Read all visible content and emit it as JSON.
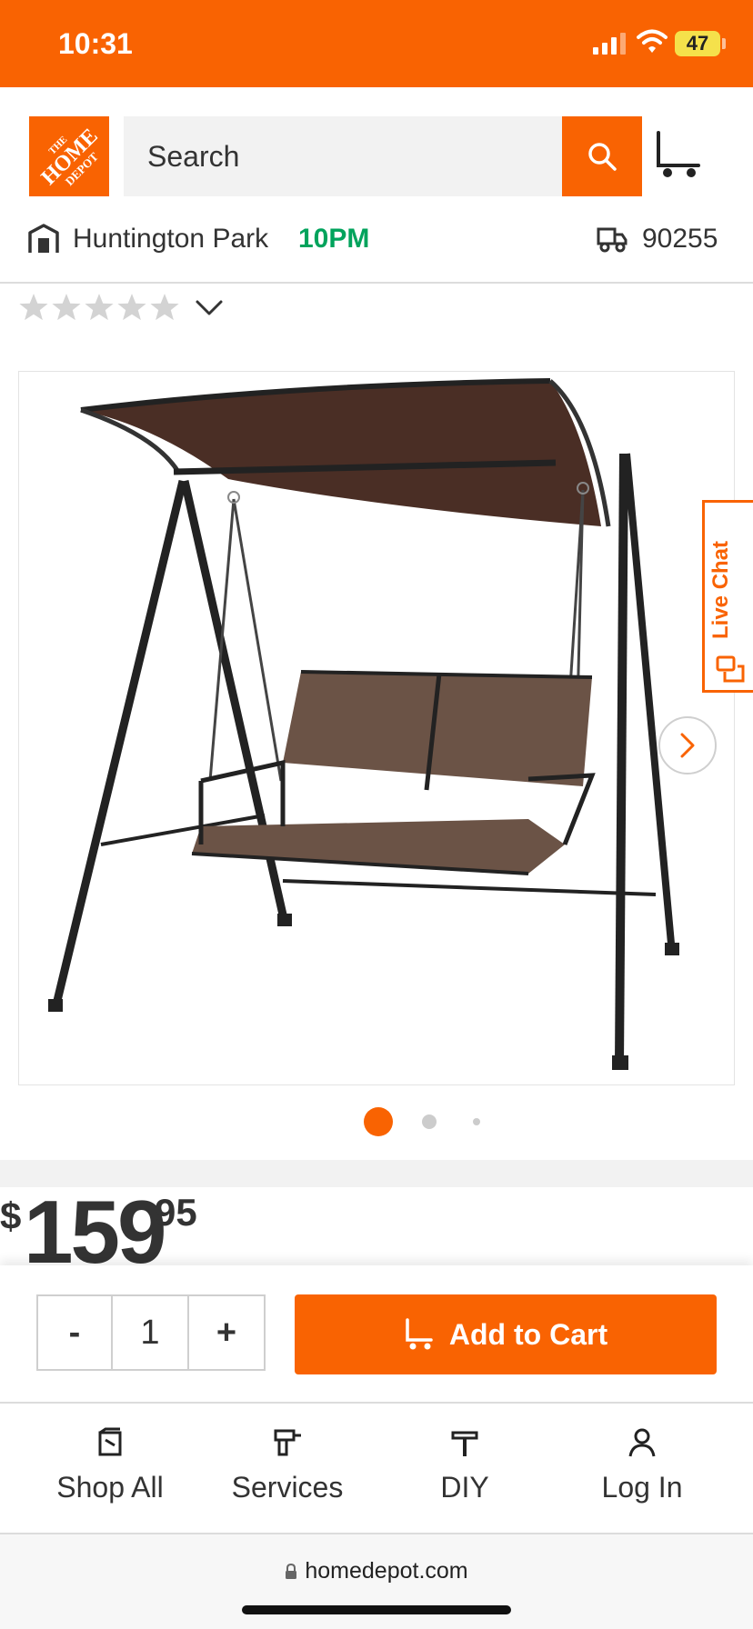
{
  "status_bar": {
    "time": "10:31",
    "battery": "47"
  },
  "header": {
    "logo_text": [
      "THE",
      "HOME",
      "DEPOT"
    ],
    "search_placeholder": "Search"
  },
  "store": {
    "name": "Huntington Park",
    "hours": "10PM",
    "zip": "90255"
  },
  "rating": {
    "stars_filled": 0,
    "stars_total": 5
  },
  "live_chat": {
    "label": "Live Chat"
  },
  "carousel": {
    "active_index": 0,
    "count": 3
  },
  "price": {
    "symbol": "$",
    "dollars": "159",
    "cents": "95"
  },
  "cart_bar": {
    "minus": "-",
    "quantity": "1",
    "plus": "+",
    "add_to_cart": "Add to Cart"
  },
  "bottom_nav": [
    {
      "label": "Shop All",
      "icon": "shop-all-icon"
    },
    {
      "label": "Services",
      "icon": "drill-icon"
    },
    {
      "label": "DIY",
      "icon": "hammer-icon"
    },
    {
      "label": "Log In",
      "icon": "user-icon"
    }
  ],
  "url_bar": {
    "url": "homedepot.com"
  },
  "colors": {
    "brand_orange": "#f96302",
    "store_green": "#00a35c"
  }
}
